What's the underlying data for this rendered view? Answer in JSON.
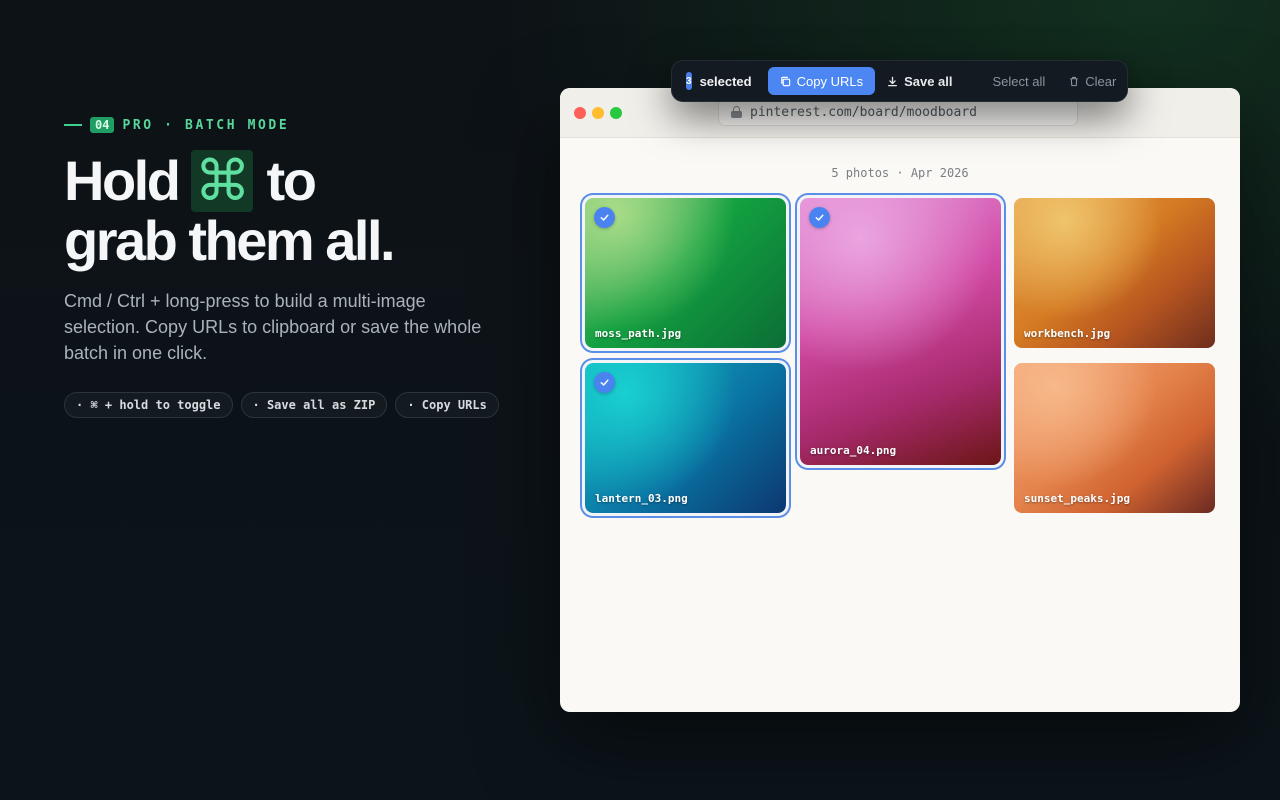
{
  "hero": {
    "eyebrow_num": "04",
    "eyebrow_text": "PRO · BATCH MODE",
    "headline_part1": "Hold",
    "headline_glyph": "⌘",
    "headline_part2": "to",
    "headline_line2": "grab them all.",
    "description": "Cmd / Ctrl + long-press to build a multi-image selection. Copy URLs to clipboard or save the whole batch in one click.",
    "chips": [
      "· ⌘ + hold to toggle",
      "· Save all as ZIP",
      "· Copy URLs"
    ]
  },
  "browser": {
    "url": "pinterest.com/board/moodboard",
    "photo_count": "5 photos · Apr 2026"
  },
  "photos": [
    {
      "name": "moss_path.jpg",
      "selected": true
    },
    {
      "name": "lantern_03.png",
      "selected": true
    },
    {
      "name": "aurora_04.png",
      "selected": true
    },
    {
      "name": "workbench.jpg",
      "selected": false
    },
    {
      "name": "sunset_peaks.jpg",
      "selected": false
    }
  ],
  "toolbar": {
    "count": "3",
    "selected_label": "selected",
    "copy_urls": "Copy URLs",
    "save_all": "Save all",
    "select_all": "Select all",
    "clear": "Clear"
  },
  "colors": {
    "accent_green": "#3ecf8e",
    "accent_blue": "#4b86f2",
    "background": "#0d1216"
  }
}
